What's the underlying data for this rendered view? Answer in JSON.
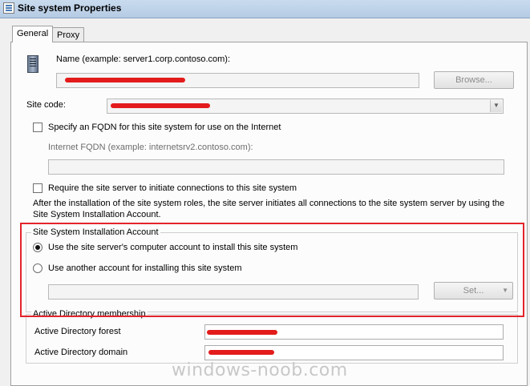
{
  "window": {
    "title": "Site system Properties"
  },
  "tabs": [
    {
      "label": "General",
      "active": true
    },
    {
      "label": "Proxy",
      "active": false
    }
  ],
  "general": {
    "name_label": "Name (example: server1.corp.contoso.com):",
    "browse_button": "Browse...",
    "site_code_label": "Site code:",
    "fqdn_checkbox_label": "Specify an FQDN for this site system for use on the Internet",
    "internet_fqdn_label": "Internet FQDN (example: internetsrv2.contoso.com):",
    "require_checkbox_label": "Require the site server to initiate connections to this site system",
    "require_description": "After the  installation of the site system roles, the site server initiates all connections to the site system server by using the Site System Installation Account.",
    "install_account": {
      "group_title": "Site System Installation Account",
      "option_computer_account": "Use the site server's computer account to install this site system",
      "option_another_account": "Use another account for installing this site system",
      "set_button": "Set...",
      "selected": "computer_account"
    },
    "ad_membership": {
      "group_title": "Active Directory membership",
      "forest_label": "Active Directory forest",
      "domain_label": "Active Directory domain"
    }
  },
  "watermark": "windows-noob.com",
  "colors": {
    "highlight": "#e3242b",
    "redaction": "#e31b1b"
  }
}
